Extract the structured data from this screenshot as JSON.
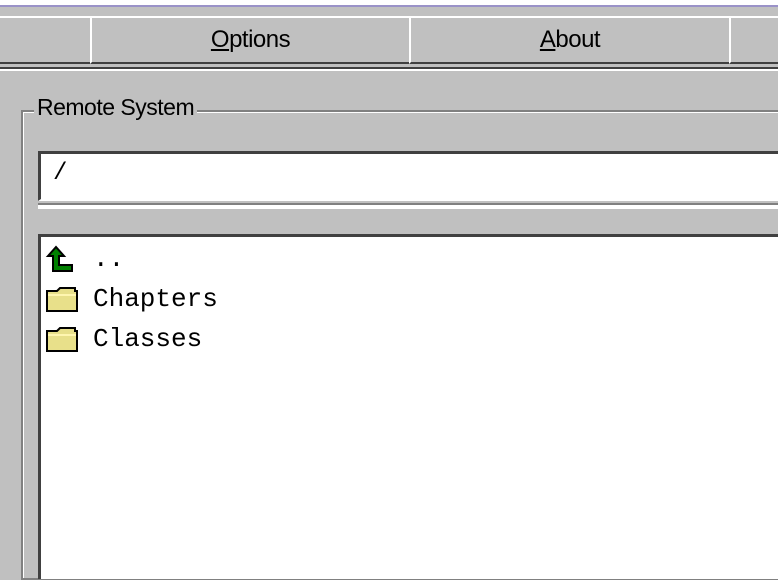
{
  "toolbar": {
    "buttons": [
      {
        "label_html_first": "O",
        "label_rest": "ptions"
      },
      {
        "label_html_first": "A",
        "label_rest": "bout"
      }
    ]
  },
  "remote_system": {
    "title": "Remote System",
    "path_value": "/",
    "items": [
      {
        "label": "..",
        "icon": "up-arrow-icon"
      },
      {
        "label": "Chapters",
        "icon": "folder-icon"
      },
      {
        "label": "Classes",
        "icon": "folder-icon"
      }
    ]
  },
  "colors": {
    "window_bg": "#c0c0c0",
    "folder": "#e8e08a",
    "up_arrow": "#008000"
  }
}
